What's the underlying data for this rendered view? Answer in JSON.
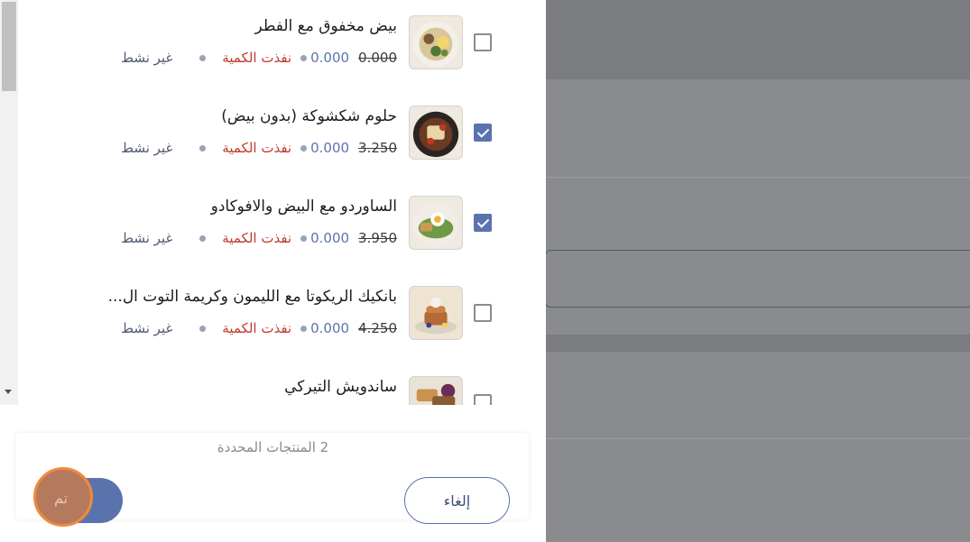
{
  "products": [
    {
      "name": "بيض مخفوق مع الفطر",
      "old_price": "0.000",
      "new_price": "0.000",
      "stock": "نفذت الكمية",
      "status": "غير نشط",
      "checked": false,
      "image": "scrambled-eggs-mushroom-plate"
    },
    {
      "name": "حلوم شكشوكة (بدون بيض)",
      "old_price": "3.250",
      "new_price": "0.000",
      "stock": "نفذت الكمية",
      "status": "غير نشط",
      "checked": true,
      "image": "halloumi-shakshuka-plate"
    },
    {
      "name": "الساوردو مع البيض والافوكادو",
      "old_price": "3.950",
      "new_price": "0.000",
      "stock": "نفذت الكمية",
      "status": "غير نشط",
      "checked": true,
      "image": "sourdough-egg-avocado-plate"
    },
    {
      "name": "بانكيك الريكوتا مع الليمون وكريمة التوت ال...",
      "old_price": "4.250",
      "new_price": "0.000",
      "stock": "نفذت الكمية",
      "status": "غير نشط",
      "checked": false,
      "image": "ricotta-pancake-stack"
    },
    {
      "name": "ساندويش التيركي",
      "checked": false,
      "image": "turkey-sandwich-plate"
    }
  ],
  "footer": {
    "selected_count": "2 المنتجات المحددة",
    "cancel_label": "إلغاء",
    "done_label": "تم"
  },
  "colors": {
    "accent": "#5b73ad",
    "stock_out": "#c0392b",
    "overlay": "#7b7c80"
  }
}
